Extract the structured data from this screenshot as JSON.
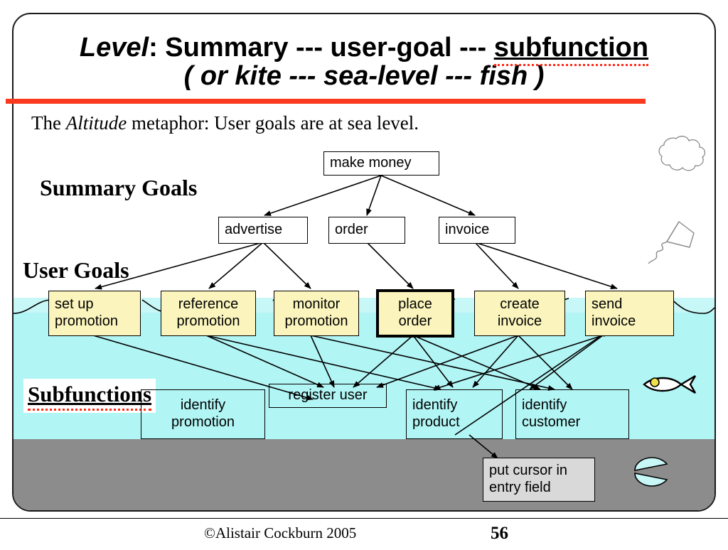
{
  "slide": {
    "title_line1_pre": "Level",
    "title_line1_mid": ": Summary  ---  user-goal  ---  ",
    "title_line1_underlined": "subfunction",
    "title_line2": "( or   kite --- sea-level ---  fish )",
    "subtitle_pre": "The ",
    "subtitle_italic": "Altitude",
    "subtitle_post": " metaphor:  User goals are at sea level.",
    "accent_color": "#fa3a1e",
    "sea_color": "#b2f5f5",
    "foam_color": "#c8f7f7",
    "seabed_color": "#8c8c8c",
    "node_fill_yellow": "#fbf5bd",
    "node_fill_gray": "#d9d9d9"
  },
  "labels": {
    "summary_goals": "Summary Goals",
    "user_goals": "User Goals",
    "subfunctions": "Subfunctions"
  },
  "nodes": {
    "make_money": {
      "line1": "make money"
    },
    "advertise": {
      "line1": "advertise"
    },
    "order": {
      "line1": "order"
    },
    "invoice": {
      "line1": "invoice"
    },
    "set_up_promotion": {
      "line1": "set up",
      "line2": "promotion"
    },
    "reference_promotion": {
      "line1": "reference",
      "line2": "promotion"
    },
    "monitor_promotion": {
      "line1": "monitor",
      "line2": "promotion"
    },
    "place_order": {
      "line1": "place",
      "line2": "order"
    },
    "create_invoice": {
      "line1": "create",
      "line2": "invoice"
    },
    "send_invoice": {
      "line1": "send",
      "line2": "invoice"
    },
    "identify_promotion": {
      "line1": "identify",
      "line2": "promotion"
    },
    "register_user": {
      "line1": "register user"
    },
    "identify_product": {
      "line1": "identify",
      "line2": "product"
    },
    "identify_customer": {
      "line1": "identify",
      "line2": "customer"
    },
    "put_cursor": {
      "line1": "put cursor in",
      "line2": "entry field"
    }
  },
  "decorations": {
    "cloud": "cloud-icon",
    "kite": "kite-icon",
    "fish": "fish-icon",
    "shell": "shell-icon"
  },
  "footer": {
    "copyright": "©Alistair Cockburn 2005",
    "page_number": "56"
  }
}
